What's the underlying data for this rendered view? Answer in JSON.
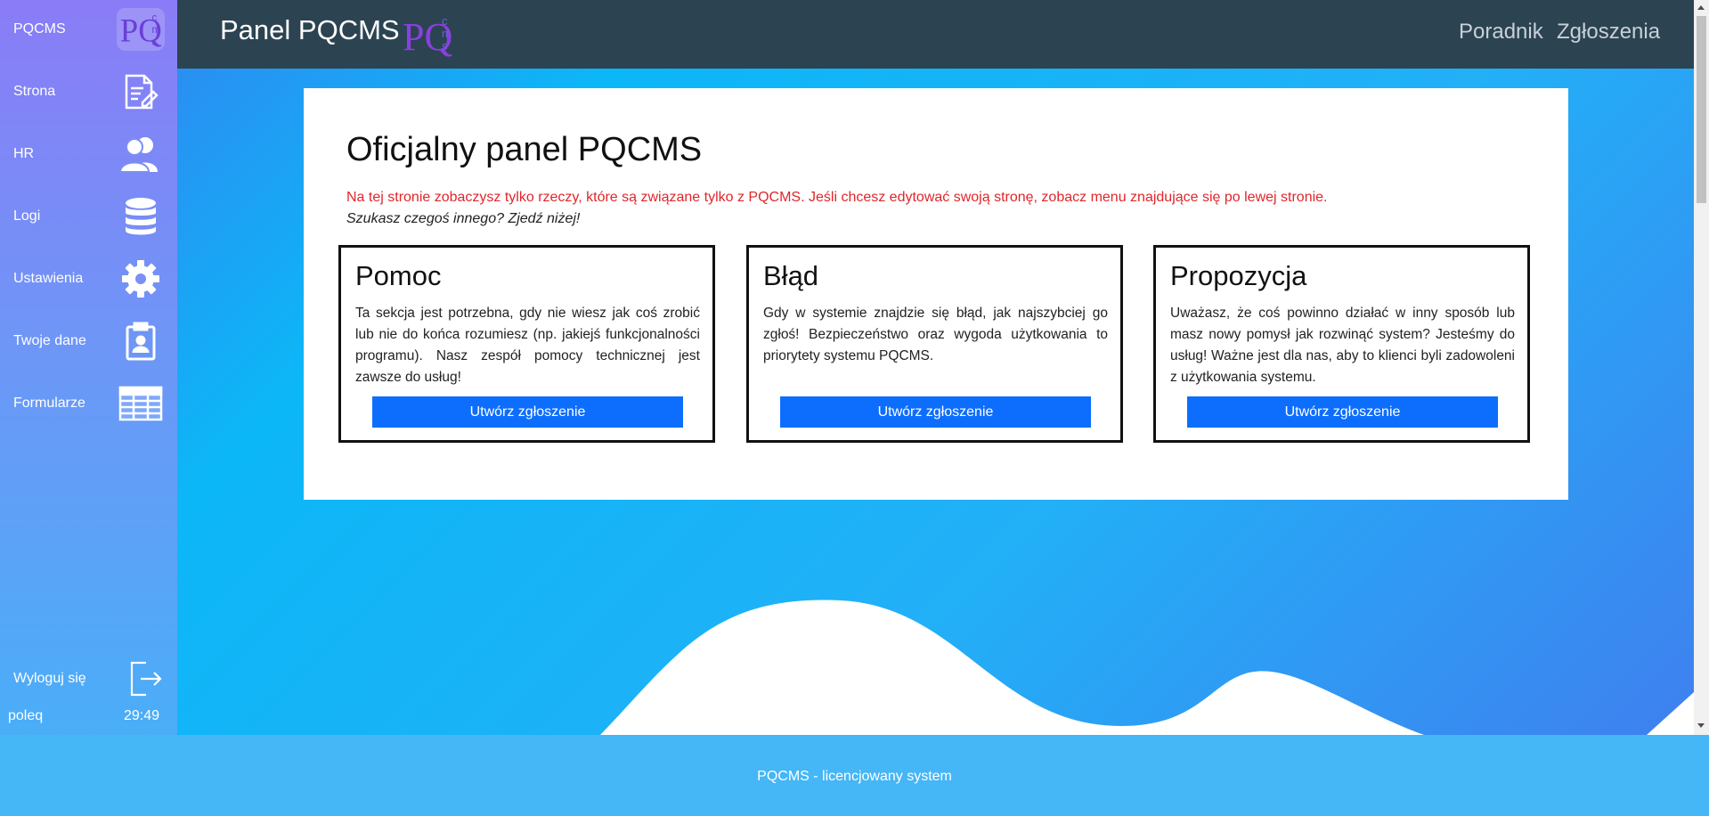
{
  "sidebar": {
    "items": [
      {
        "label": "PQCMS",
        "icon": "pqcms-logo-icon"
      },
      {
        "label": "Strona",
        "icon": "page-edit-icon"
      },
      {
        "label": "HR",
        "icon": "users-icon"
      },
      {
        "label": "Logi",
        "icon": "database-icon"
      },
      {
        "label": "Ustawienia",
        "icon": "gear-icon"
      },
      {
        "label": "Twoje dane",
        "icon": "clipboard-user-icon"
      },
      {
        "label": "Formularze",
        "icon": "table-icon"
      }
    ],
    "logout": {
      "label": "Wyloguj się",
      "icon": "logout-icon"
    },
    "username": "poleq",
    "timer": "29:49"
  },
  "topbar": {
    "brand": "Panel PQCMS",
    "links": [
      "Poradnik",
      "Zgłoszenia"
    ]
  },
  "main": {
    "title": "Oficjalny panel PQCMS",
    "description": "Na tej stronie zobaczysz tylko rzeczy, które są związane tylko z PQCMS. Jeśli chcesz edytować swoją stronę, zobacz menu znajdujące się po lewej stronie.",
    "subtitle": "Szukasz czegoś innego? Zjedź niżej!",
    "cards": [
      {
        "title": "Pomoc",
        "text": "Ta sekcja jest potrzebna, gdy nie wiesz jak coś zrobić lub nie do końca rozumiesz (np. jakiejś funkcjonalności programu). Nasz zespół pomocy technicznej jest zawsze do usług!",
        "button": "Utwórz zgłoszenie"
      },
      {
        "title": "Błąd",
        "text": "Gdy w systemie znajdzie się błąd, jak najszybciej go zgłoś! Bezpieczeństwo oraz wygoda użytkowania to priorytety systemu PQCMS.",
        "button": "Utwórz zgłoszenie"
      },
      {
        "title": "Propozycja",
        "text": "Uważasz, że coś powinno działać w inny sposób lub masz nowy pomysł jak rozwinąć system? Jesteśmy do usług! Ważne jest dla nas, aby to klienci byli zadowoleni z użytkowania systemu.",
        "button": "Utwórz zgłoszenie"
      }
    ]
  },
  "footer": {
    "text": "PQCMS - licencjowany system"
  },
  "colors": {
    "topbar": "#2c4352",
    "button": "#0d6efd",
    "description": "#e0262b",
    "footer": "#45b6f6"
  }
}
